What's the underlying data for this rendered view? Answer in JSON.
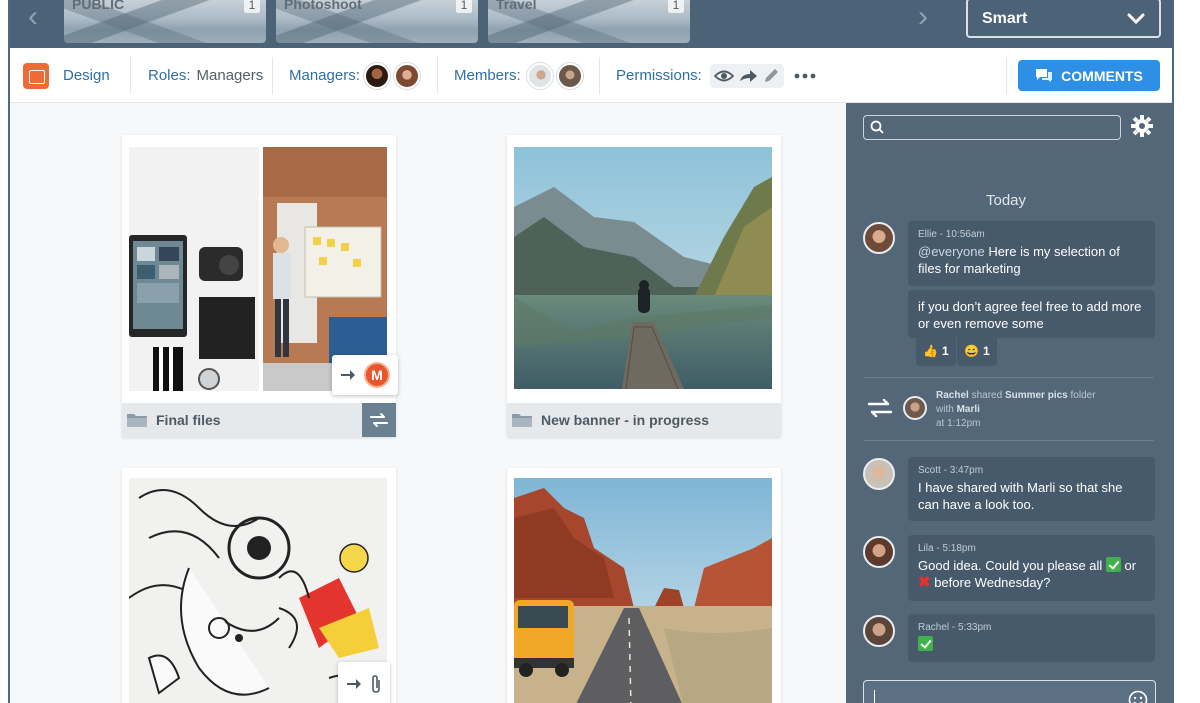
{
  "albums": [
    {
      "name": "PUBLIC",
      "count": "1"
    },
    {
      "name": "Photoshoot",
      "count": "1"
    },
    {
      "name": "Travel",
      "count": "1"
    }
  ],
  "smart_select": {
    "value": "Smart"
  },
  "infobar": {
    "design_label": "Design",
    "roles_label": "Roles:",
    "roles_value": "Managers",
    "managers_label": "Managers:",
    "members_label": "Members:",
    "permissions_label": "Permissions:",
    "comments_button": "COMMENTS"
  },
  "cards": [
    {
      "title": "Final files"
    },
    {
      "title": "New banner - in progress"
    },
    {
      "title": ""
    },
    {
      "title": ""
    }
  ],
  "chat": {
    "today_label": "Today",
    "messages": [
      {
        "author": "Ellie",
        "time": "10:56am",
        "mention": "@everyone",
        "text": "Here is my selection of files for marketing"
      },
      {
        "text": "if you don’t agree feel free to add more or even remove some"
      },
      {
        "author": "Scott",
        "time": "3:47pm",
        "text": "I have shared with Marli so that she can have a look too."
      },
      {
        "author": "Lila",
        "time": "5:18pm",
        "text_a": "Good idea. Could you please all",
        "text_b": "or",
        "text_c": "before Wednesday?"
      },
      {
        "author": "Rachel",
        "time": "5:33pm"
      }
    ],
    "reactions": [
      {
        "emoji": "👍",
        "count": "1"
      },
      {
        "emoji": "😄",
        "count": "1"
      }
    ],
    "system": {
      "actor": "Rachel",
      "action": "shared",
      "folder": "Summer pics",
      "suffix": "folder",
      "with_label": "with",
      "with_name": "Marli",
      "time": "at 1:12pm"
    }
  },
  "colors": {
    "accent": "#2e8fe6",
    "chat_bg": "#536779",
    "design_icon": "#ef6a37",
    "header_bg": "#4b6277"
  }
}
